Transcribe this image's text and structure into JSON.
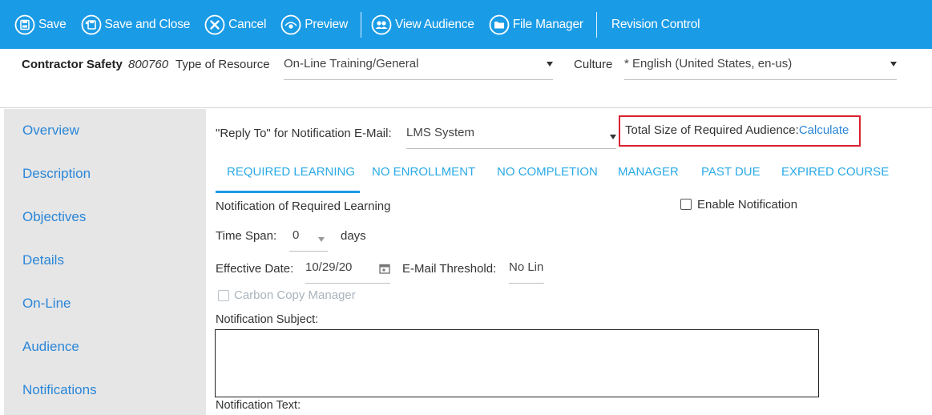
{
  "toolbar": {
    "save": "Save",
    "save_close": "Save and Close",
    "cancel": "Cancel",
    "preview": "Preview",
    "view_audience": "View Audience",
    "file_manager": "File Manager",
    "revision_control": "Revision Control"
  },
  "header": {
    "title": "Contractor Safety",
    "code": "800760",
    "type_label": "Type of Resource",
    "type_value": "On-Line Training/General",
    "culture_label": "Culture",
    "culture_value": "* English (United States, en-us)"
  },
  "sidebar": {
    "items": [
      "Overview",
      "Description",
      "Objectives",
      "Details",
      "On-Line",
      "Audience",
      "Notifications"
    ]
  },
  "main": {
    "reply_to_label": "\"Reply To\" for Notification E-Mail:",
    "reply_to_value": "LMS System",
    "total_size_label": "Total Size of Required Audience:",
    "calculate": "Calculate",
    "tabs": [
      "REQUIRED LEARNING",
      "NO ENROLLMENT",
      "NO COMPLETION",
      "MANAGER",
      "PAST DUE",
      "EXPIRED COURSE"
    ],
    "section_title": "Notification of Required Learning",
    "enable_notification": "Enable Notification",
    "time_span_label": "Time Span:",
    "time_span_value": "0",
    "time_span_unit": "days",
    "effective_date_label": "Effective Date:",
    "effective_date_value": "10/29/20",
    "email_threshold_label": "E-Mail Threshold:",
    "email_threshold_value": "No Lin",
    "carbon_copy": "Carbon Copy Manager",
    "subject_label": "Notification Subject:",
    "text_label": "Notification Text:"
  },
  "colors": {
    "toolbar_bg": "#1a9be6",
    "link": "#2a86d8",
    "tab": "#2aaae6",
    "highlight_border": "#d9232e",
    "sidebar_bg": "#e6e6e6"
  },
  "icons": [
    "save-icon",
    "save-close-icon",
    "cancel-icon",
    "preview-icon",
    "audience-icon",
    "folder-icon",
    "calendar-icon",
    "caret-down-icon"
  ]
}
